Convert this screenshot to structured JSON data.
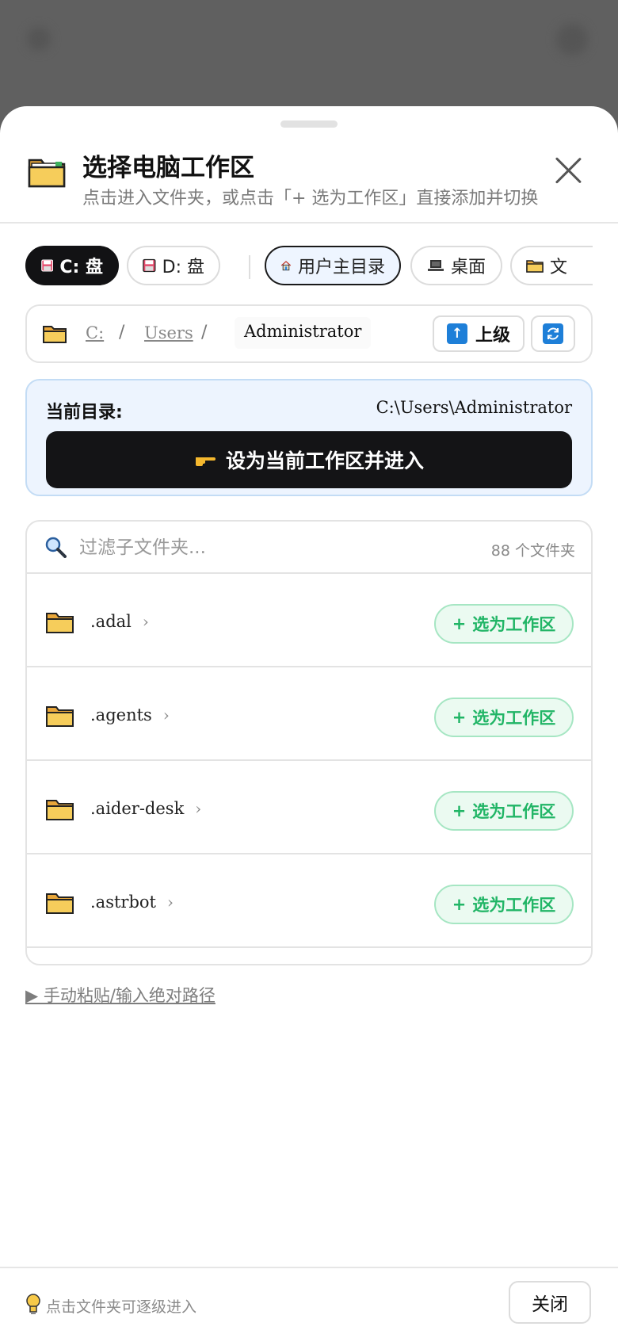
{
  "header": {
    "title": "选择电脑工作区",
    "subtitle": "点击进入文件夹，或点击「+ 选为工作区」直接添加并切换"
  },
  "quick_locations": [
    {
      "label": "C: 盘",
      "icon": "floppy-disk-icon",
      "active": true
    },
    {
      "label": "D: 盘",
      "icon": "floppy-disk-icon",
      "active": false
    },
    {
      "label": "用户主目录",
      "icon": "house-icon",
      "active": false
    },
    {
      "label": "桌面",
      "icon": "laptop-icon",
      "active": false
    },
    {
      "label": "文",
      "icon": "folder-icon",
      "active": false
    }
  ],
  "breadcrumb": {
    "parts": [
      "C:",
      "Users"
    ],
    "separator": "/",
    "current": "Administrator",
    "up_label": "上级"
  },
  "current_dir": {
    "label": "当前目录:",
    "path": "C:\\Users\\Administrator",
    "set_button": "设为当前工作区并进入"
  },
  "filter": {
    "placeholder": "过滤子文件夹...",
    "count": "88 个文件夹"
  },
  "folders": [
    {
      "name": ".adal",
      "action": "选为工作区"
    },
    {
      "name": ".agents",
      "action": "选为工作区"
    },
    {
      "name": ".aider-desk",
      "action": "选为工作区"
    },
    {
      "name": ".astrbot",
      "action": "选为工作区"
    }
  ],
  "manual_input_label": "▶ 手动粘贴/输入绝对路径",
  "footer": {
    "hint": "点击文件夹可逐级进入",
    "close_label": "关闭"
  },
  "colors": {
    "accent_dark": "#141416",
    "select_green": "#21b566",
    "select_bg": "#ebfaf1",
    "current_bg": "#edf4fe"
  }
}
